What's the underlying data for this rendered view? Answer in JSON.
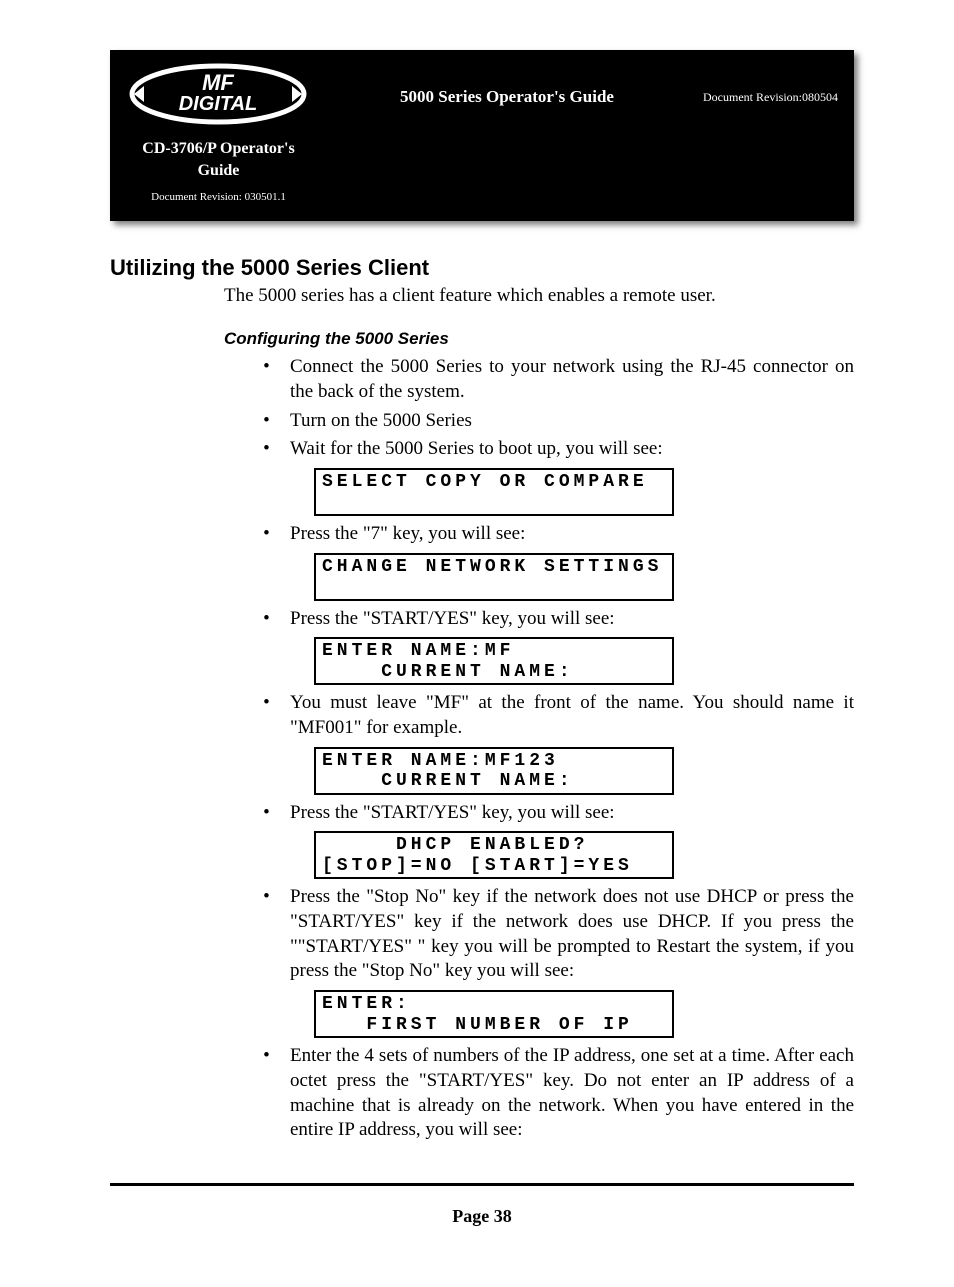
{
  "header": {
    "center_title": "5000 Series Operator's Guide",
    "doc_rev_top": "Document Revision:080504",
    "sub_title": "CD-3706/P Operator's Guide",
    "sub_rev": "Document Revision: 030501.1",
    "logo_top": "MF",
    "logo_bottom": "DIGITAL"
  },
  "section": {
    "heading": "Utilizing the 5000 Series Client",
    "intro": "The 5000 series has a client feature which enables a remote user.",
    "subheading": "Configuring the 5000 Series"
  },
  "steps": {
    "s1": "Connect the 5000 Series to your network using the RJ-45 connector on the back of the system.",
    "s2": "Turn on the 5000 Series",
    "s3": "Wait for the 5000 Series to boot up, you will see:",
    "s4": "Press the \"7\" key, you will see:",
    "s5": "Press the \"START/YES\" key, you will see:",
    "s6": "You must leave \"MF\" at the front of the name. You should name it \"MF001\" for example.",
    "s7": "Press the \"START/YES\" key, you will see:",
    "s8": "Press the \"Stop No\" key if the network does not use DHCP or press the \"START/YES\" key if the network does use DHCP. If you press the \"\"START/YES\" \" key you will be prompted to Restart the system, if you press the \"Stop No\" key you will see:",
    "s9": "Enter the 4 sets of numbers of the IP address, one set at a time. After each octet press the \"START/YES\" key. Do not enter an IP address of a machine that is already on the network. When you have entered in the entire IP address, you will see:"
  },
  "lcd": {
    "d1": "SELECT COPY OR COMPARE\n ",
    "d2": "CHANGE NETWORK SETTINGS\n ",
    "d3": "ENTER NAME:MF\n    CURRENT NAME:",
    "d4": "ENTER NAME:MF123\n    CURRENT NAME:",
    "d5": "     DHCP ENABLED?\n[STOP]=NO [START]=YES",
    "d6": "ENTER:\n   FIRST NUMBER OF IP"
  },
  "footer": {
    "page": "Page 38"
  }
}
